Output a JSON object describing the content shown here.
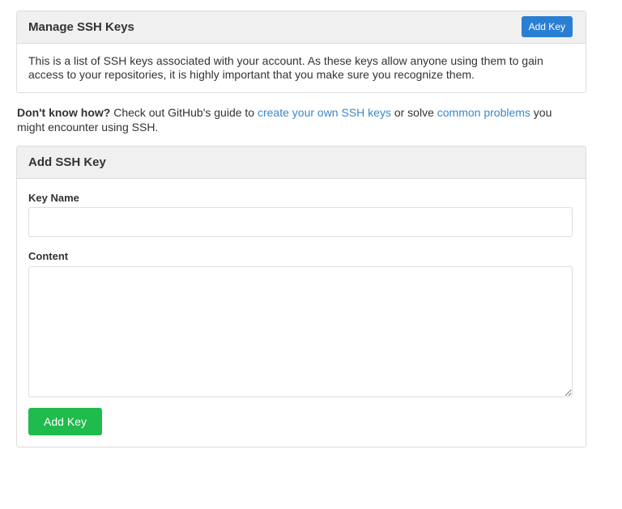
{
  "manage": {
    "title": "Manage SSH Keys",
    "add_button": "Add Key",
    "description": "This is a list of SSH keys associated with your account. As these keys allow anyone using them to gain access to your repositories, it is highly important that you make sure you recognize them."
  },
  "guide": {
    "bold": "Don't know how?",
    "text1": " Check out GitHub's guide to ",
    "link1": "create your own SSH keys",
    "text2": " or solve ",
    "link2": "common problems",
    "text3": " you might encounter using SSH."
  },
  "add": {
    "title": "Add SSH Key",
    "key_name_label": "Key Name",
    "key_name_value": "",
    "content_label": "Content",
    "content_value": "",
    "submit": "Add Key"
  }
}
